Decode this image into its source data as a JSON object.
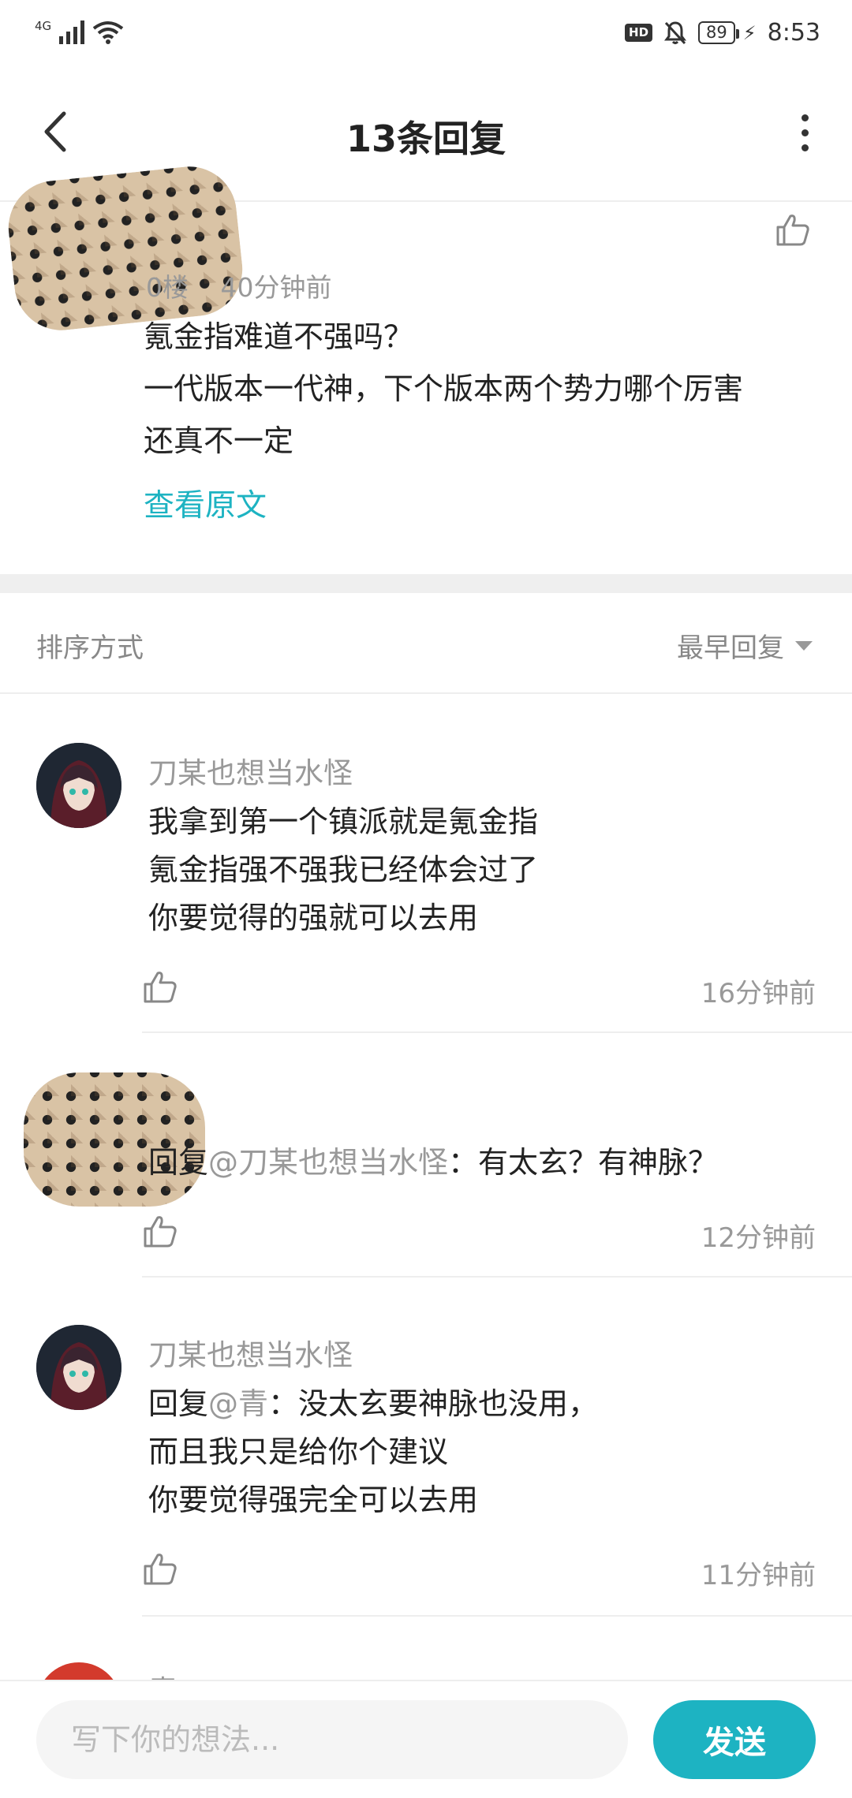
{
  "status_bar": {
    "network": "4G",
    "hd_label": "HD",
    "battery": "89",
    "time": "8:53"
  },
  "header": {
    "title": "13条回复"
  },
  "post": {
    "floor": "0楼",
    "time": "40分钟前",
    "lines": [
      "氪金指难道不强吗？",
      "一代版本一代神，下个版本两个势力哪个厉害",
      "还真不一定"
    ],
    "view_original": "查看原文"
  },
  "sort": {
    "label": "排序方式",
    "selected": "最早回复"
  },
  "replies": [
    {
      "user": "刀某也想当水怪",
      "lines": [
        "我拿到第一个镇派就是氪金指",
        "氪金指强不强我已经体会过了",
        "你要觉得的强就可以去用"
      ],
      "time": "16分钟前"
    },
    {
      "user": "",
      "reply_prefix": "回复",
      "mention": "@刀某也想当水怪",
      "text": "：有太玄？有神脉？",
      "time": "12分钟前"
    },
    {
      "user": "刀某也想当水怪",
      "reply_prefix": "回复",
      "mention": "@青",
      "first_text": "：没太玄要神脉也没用，",
      "lines": [
        "而且我只是给你个建议",
        "你要觉得强完全可以去用"
      ],
      "time": "11分钟前"
    },
    {
      "user": "青"
    }
  ],
  "composer": {
    "placeholder": "写下你的想法...",
    "send_label": "发送"
  },
  "colors": {
    "accent": "#1db3c2",
    "muted_text": "#999999",
    "divider": "#efefef"
  }
}
